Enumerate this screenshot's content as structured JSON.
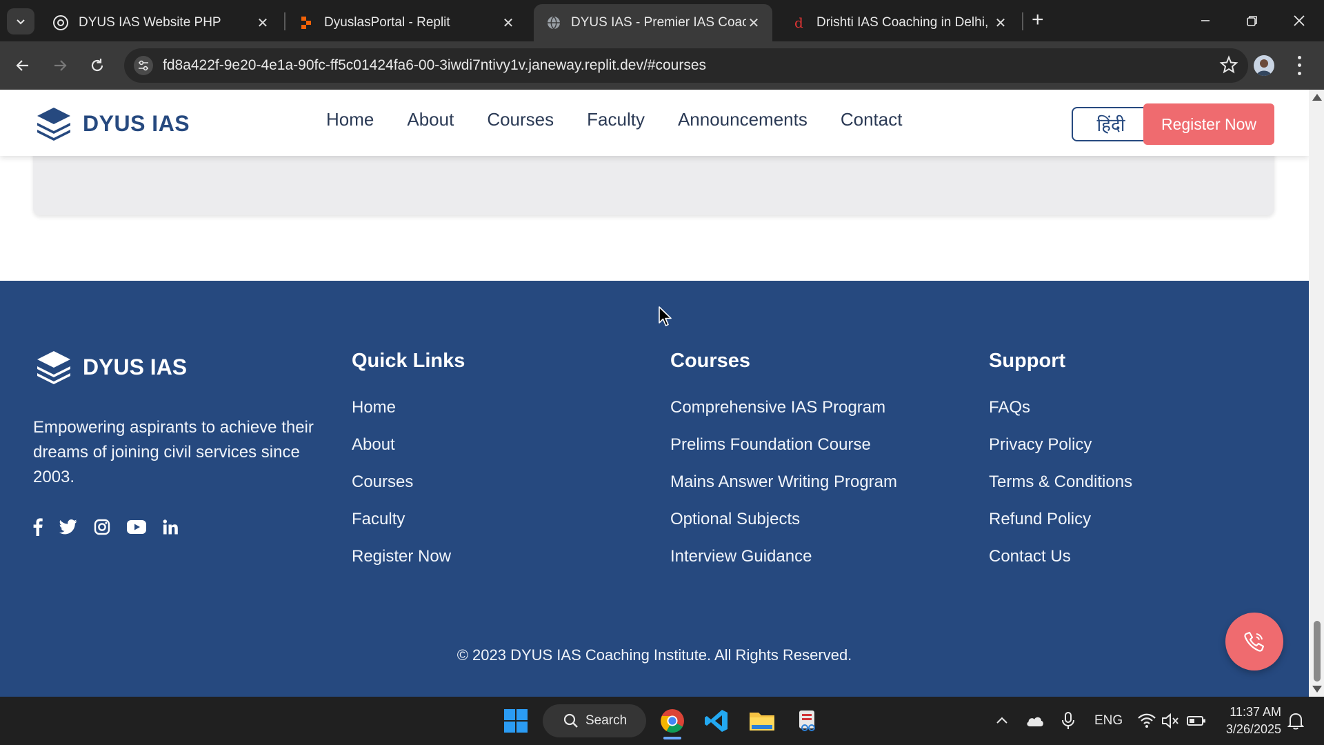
{
  "browser": {
    "tabs": [
      {
        "title": "DYUS IAS Website PHP",
        "active": false
      },
      {
        "title": "DyuslasPortal - Replit",
        "active": false
      },
      {
        "title": "DYUS IAS - Premier IAS Coachin",
        "active": true
      },
      {
        "title": "Drishti IAS Coaching in Delhi, Be",
        "active": false
      }
    ],
    "url": "fd8a422f-9e20-4e1a-90fc-ff5c01424fa6-00-3iwdi7ntivy1v.janeway.replit.dev/#courses"
  },
  "header": {
    "logo_text": "DYUS IAS",
    "nav": [
      "Home",
      "About",
      "Courses",
      "Faculty",
      "Announcements",
      "Contact"
    ],
    "lang_button": "हिंदी",
    "register_button": "Register Now"
  },
  "footer": {
    "logo_text": "DYUS IAS",
    "description": "Empowering aspirants to achieve their dreams of joining civil services since 2003.",
    "socials": [
      "facebook-icon",
      "twitter-icon",
      "instagram-icon",
      "youtube-icon",
      "linkedin-icon"
    ],
    "quick_links": {
      "heading": "Quick Links",
      "items": [
        "Home",
        "About",
        "Courses",
        "Faculty",
        "Register Now"
      ]
    },
    "courses": {
      "heading": "Courses",
      "items": [
        "Comprehensive IAS Program",
        "Prelims Foundation Course",
        "Mains Answer Writing Program",
        "Optional Subjects",
        "Interview Guidance"
      ]
    },
    "support": {
      "heading": "Support",
      "items": [
        "FAQs",
        "Privacy Policy",
        "Terms & Conditions",
        "Refund Policy",
        "Contact Us"
      ]
    },
    "copyright": "© 2023 DYUS IAS Coaching Institute. All Rights Reserved."
  },
  "taskbar": {
    "search_label": "Search",
    "language": "ENG",
    "time": "11:37 AM",
    "date": "3/26/2025"
  },
  "colors": {
    "brand_navy": "#26497f",
    "accent_coral": "#ef6b6f"
  }
}
